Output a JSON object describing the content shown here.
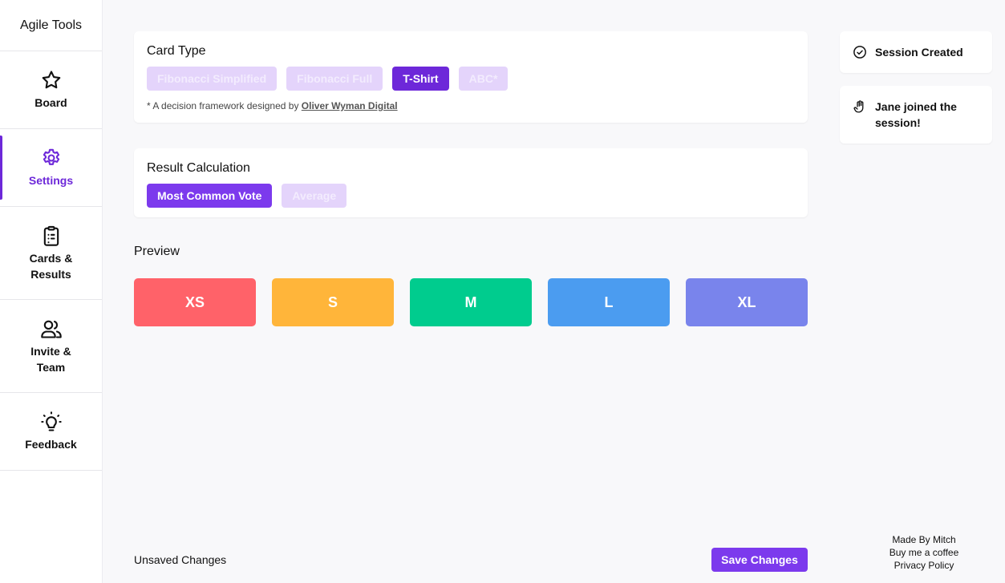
{
  "app": {
    "title": "Agile Tools"
  },
  "sidebar": {
    "items": [
      {
        "label": "Board",
        "icon": "star-icon"
      },
      {
        "label": "Settings",
        "icon": "gear-icon",
        "active": true
      },
      {
        "label": "Cards & Results",
        "icon": "clipboard-list-icon"
      },
      {
        "label": "Invite & Team",
        "icon": "users-icon"
      },
      {
        "label": "Feedback",
        "icon": "lightbulb-icon"
      }
    ]
  },
  "card_type": {
    "title": "Card Type",
    "options": [
      "Fibonacci Simplified",
      "Fibonacci Full",
      "T-Shirt",
      "ABC*"
    ],
    "selected": "T-Shirt",
    "note_prefix": "* A decision framework designed by ",
    "note_link": "Oliver Wyman Digital"
  },
  "result_calculation": {
    "title": "Result Calculation",
    "options": [
      "Most Common Vote",
      "Average"
    ],
    "selected": "Most Common Vote"
  },
  "preview": {
    "title": "Preview",
    "cards": [
      {
        "label": "XS",
        "color": "#ff6269"
      },
      {
        "label": "S",
        "color": "#ffb53a"
      },
      {
        "label": "M",
        "color": "#00cc8e"
      },
      {
        "label": "L",
        "color": "#4b9cf0"
      },
      {
        "label": "XL",
        "color": "#7984ec"
      }
    ]
  },
  "notifications": [
    {
      "text": "Session Created",
      "icon": "check-circle-icon"
    },
    {
      "text": "Jane joined the session!",
      "icon": "hand-icon"
    }
  ],
  "footer": {
    "status": "Unsaved Changes",
    "save_label": "Save Changes",
    "links": [
      "Made By Mitch",
      "Buy me a coffee",
      "Privacy Policy"
    ]
  },
  "colors": {
    "accent": "#6d28d9",
    "accent_light": "#e4d4fb"
  }
}
